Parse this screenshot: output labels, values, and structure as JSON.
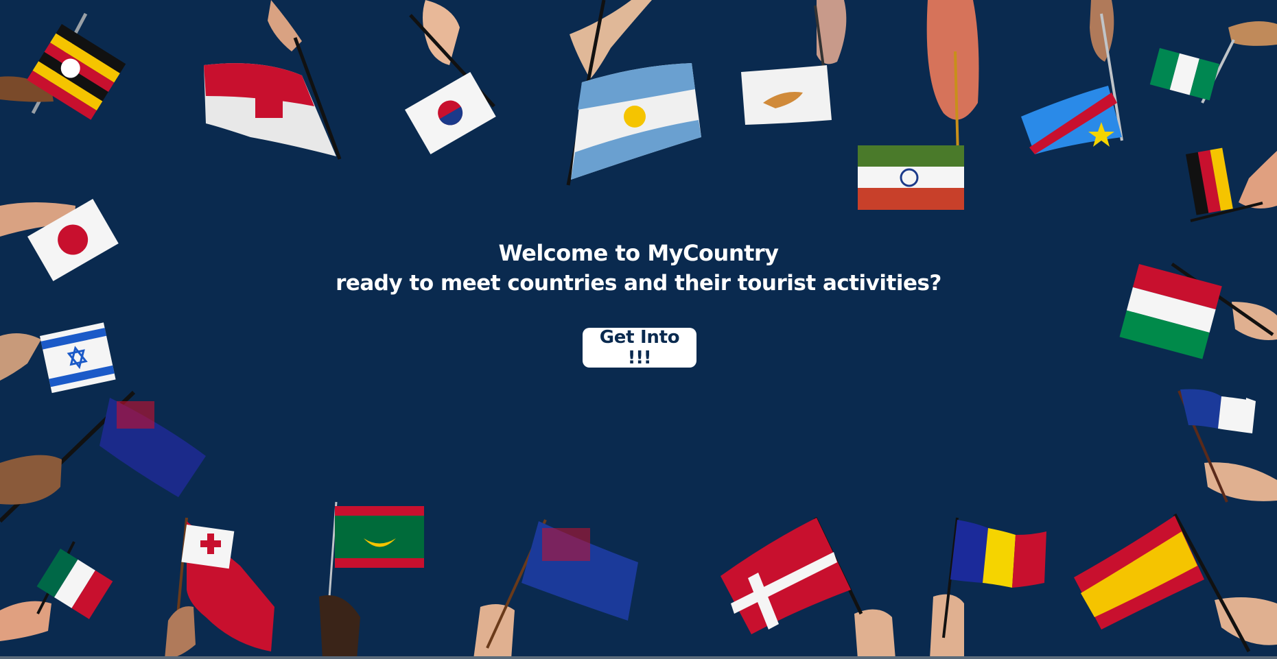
{
  "hero": {
    "title": "Welcome to MyCountry",
    "subtitle": "ready to meet countries and their tourist activities?",
    "cta_label": "Get Into !!!"
  },
  "colors": {
    "background": "#0a2a4f",
    "text": "#ffffff",
    "button_bg": "#ffffff",
    "button_text": "#0a2a4f"
  },
  "decorative_flags": [
    "uganda-flag-icon",
    "gibraltar-flag-icon",
    "south-korea-flag-icon",
    "argentina-flag-icon",
    "cyprus-flag-icon",
    "india-flag-icon",
    "dr-congo-flag-icon",
    "nigeria-flag-icon",
    "germany-flag-icon",
    "japan-flag-icon",
    "israel-flag-icon",
    "new-zealand-flag-icon",
    "italy-flag-icon",
    "france-flag-icon",
    "mexico-flag-icon",
    "tonga-flag-icon",
    "mauritania-flag-icon",
    "denmark-flag-icon",
    "andorra-flag-icon",
    "spain-flag-icon"
  ]
}
